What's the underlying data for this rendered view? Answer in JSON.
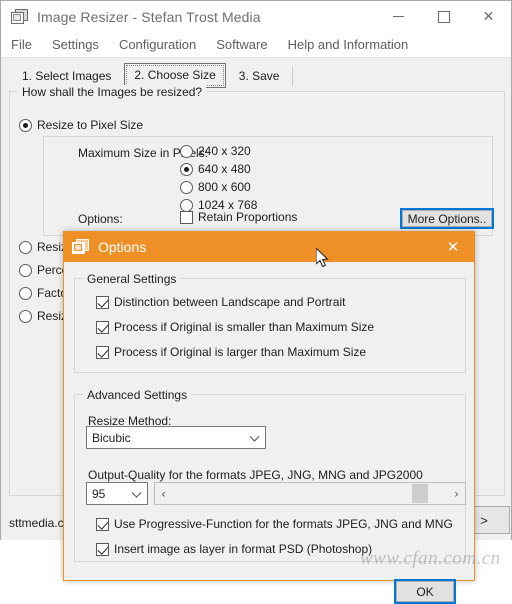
{
  "main_window": {
    "title": "Image Resizer - Stefan Trost Media",
    "app_icon": "stacked-frames-icon",
    "controls": {
      "minimize": "minimize-icon",
      "maximize": "maximize-icon",
      "close": "close-icon"
    },
    "menu": [
      {
        "label": "File"
      },
      {
        "label": "Settings"
      },
      {
        "label": "Configuration"
      },
      {
        "label": "Software"
      },
      {
        "label": "Help and Information"
      }
    ],
    "tabs": [
      {
        "label": "1. Select Images",
        "selected": false
      },
      {
        "label": "2. Choose Size",
        "selected": true
      },
      {
        "label": "3. Save",
        "selected": false
      }
    ],
    "group_how": {
      "legend": "How shall the Images be resized?",
      "modes": [
        {
          "label": "Resize to Pixel Size",
          "selected": true
        },
        {
          "label": "Resize",
          "selected": false,
          "truncated": true
        },
        {
          "label": "Perce",
          "selected": false,
          "truncated": true
        },
        {
          "label": "Facto",
          "selected": false,
          "truncated": true
        },
        {
          "label": "Resize",
          "selected": false,
          "truncated": true
        }
      ],
      "pixel_panel": {
        "max_size_label": "Maximum Size in Pixels:",
        "sizes": [
          {
            "label": "240 x 320",
            "selected": false
          },
          {
            "label": "640 x 480",
            "selected": true
          },
          {
            "label": "800 x 600",
            "selected": false
          },
          {
            "label": "1024 x 768",
            "selected": false
          }
        ],
        "options_label": "Options:",
        "retain_proportions": {
          "label": "Retain Proportions",
          "checked": false
        },
        "more_options_button": "More Options.."
      }
    },
    "status_text": "sttmedia.co",
    "next_button": ">"
  },
  "options_dialog": {
    "title": "Options",
    "app_icon": "stacked-frames-icon",
    "close_label": "✕",
    "general_settings": {
      "legend": "General Settings",
      "checkboxes": [
        {
          "label": "Distinction between Landscape and Portrait",
          "checked": true
        },
        {
          "label": "Process if Original is smaller than Maximum Size",
          "checked": true
        },
        {
          "label": "Process if Original is larger than Maximum Size",
          "checked": true
        }
      ]
    },
    "advanced_settings": {
      "legend": "Advanced Settings",
      "resize_method_label": "Resize Method:",
      "resize_method_value": "Bicubic",
      "quality_label": "Output-Quality for the formats JPEG, JNG, MNG and JPG2000",
      "quality_value": "95",
      "slider_left_arrow": "‹",
      "slider_right_arrow": "›",
      "checkboxes": [
        {
          "label": "Use Progressive-Function for the formats JPEG, JNG and MNG",
          "checked": true
        },
        {
          "label": "Insert image as layer in format PSD (Photoshop)",
          "checked": true
        }
      ]
    },
    "ok_button": "OK"
  },
  "watermark": "www.cfan.com.cn",
  "colors": {
    "dialog_title_bg": "#ef9026",
    "focus_border": "#0078d7",
    "window_bg": "#f0f0f0"
  }
}
